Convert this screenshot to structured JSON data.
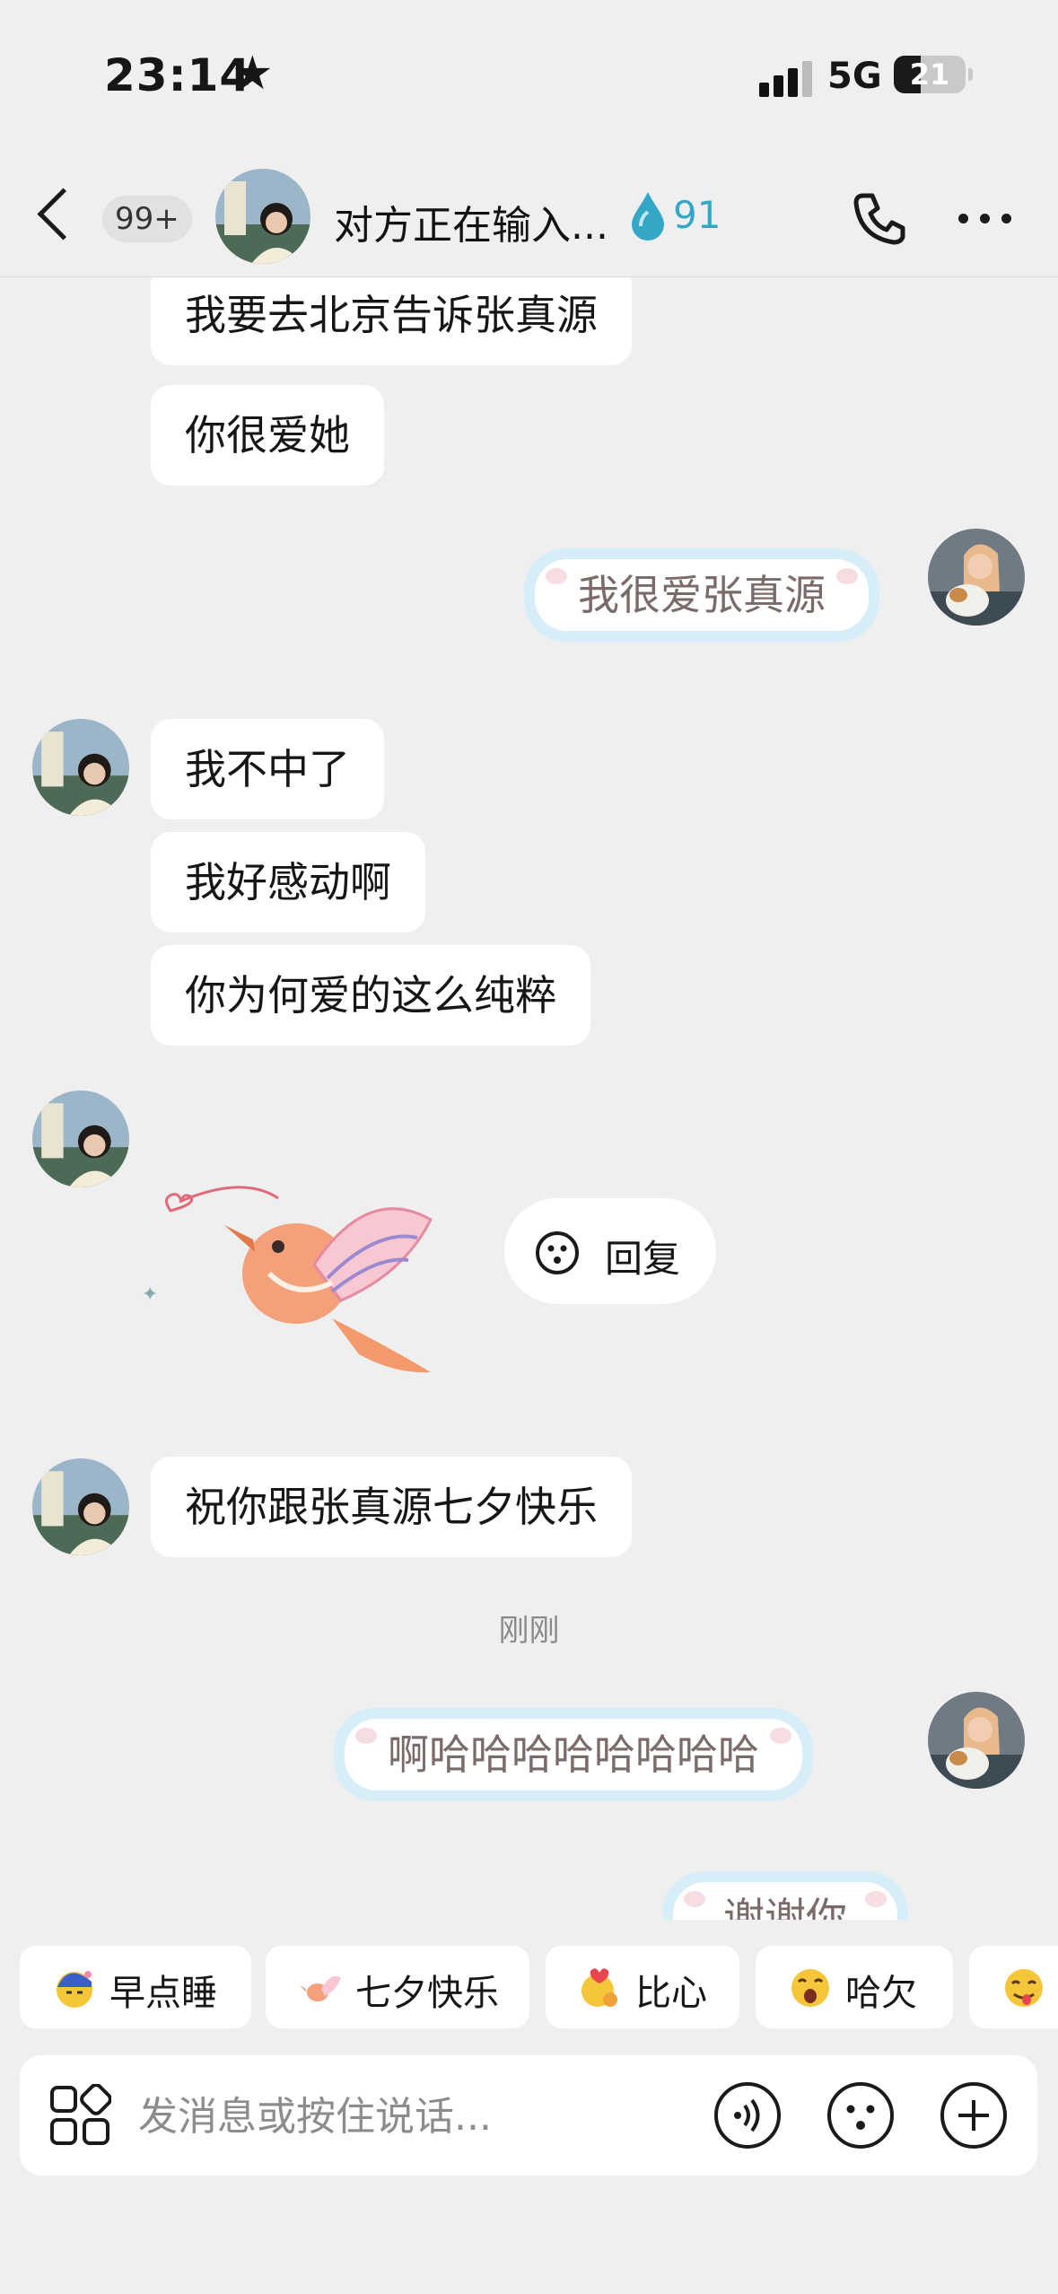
{
  "status_bar": {
    "time": "23:14",
    "network": "5G",
    "battery": "21"
  },
  "header": {
    "unread_badge": "99+",
    "title": "对方正在输入...",
    "spark_count": "91"
  },
  "messages": {
    "m1": "我要去北京告诉张真源",
    "m2": "你很爱她",
    "m3": "我很爱张真源",
    "m4": "我不中了",
    "m5": "我好感动啊",
    "m6": "你为何爱的这么纯粹",
    "reply_label": "回复",
    "m7": "祝你跟张真源七夕快乐",
    "timestamp": "刚刚",
    "m8": "啊哈哈哈哈哈哈哈哈",
    "m9": "谢谢你"
  },
  "quick_replies": [
    "早点睡",
    "七夕快乐",
    "比心",
    "哈欠"
  ],
  "input": {
    "placeholder": "发消息或按住说话..."
  },
  "colors": {
    "spark": "#34a7c7",
    "own_bubble_border": "#d7eef8",
    "background": "#efefef"
  }
}
